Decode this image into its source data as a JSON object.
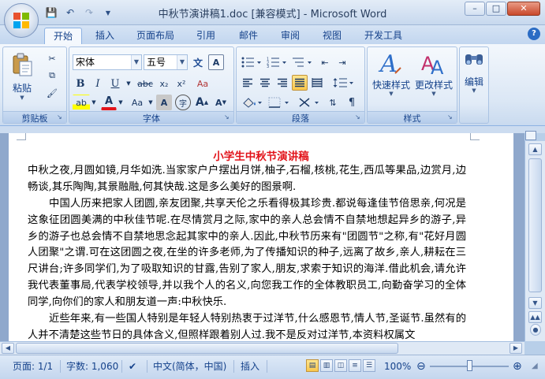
{
  "window": {
    "title": "中秋节演讲稿1.doc [兼容模式] - Microsoft Word",
    "controls": {
      "minimize": "–",
      "maximize": "□",
      "close": "✕"
    }
  },
  "qat": {
    "save": "💾",
    "undo": "↶",
    "redo": "↷"
  },
  "tabs": [
    {
      "label": "开始",
      "active": true
    },
    {
      "label": "插入"
    },
    {
      "label": "页面布局"
    },
    {
      "label": "引用"
    },
    {
      "label": "邮件"
    },
    {
      "label": "审阅"
    },
    {
      "label": "视图"
    },
    {
      "label": "开发工具"
    }
  ],
  "ribbon": {
    "clipboard": {
      "label": "剪贴板",
      "paste": "粘贴",
      "paste_arrow": "▼"
    },
    "font": {
      "label": "字体",
      "font_name": "宋体",
      "font_size": "五号",
      "grow": "A",
      "shrink": "A",
      "bold": "B",
      "italic": "I",
      "underline": "U",
      "strike": "abc",
      "subscript": "x₂",
      "superscript": "x²",
      "clear": "Aa",
      "highlight": "ab",
      "font_color": "A",
      "change_case": "Aa",
      "char_shading": "A",
      "enclose": "字",
      "phonetic": "文",
      "char_border": "A"
    },
    "paragraph": {
      "label": "段落"
    },
    "styles": {
      "label": "样式",
      "quick_styles": "快速样式",
      "change_styles": "更改样式"
    },
    "editing": {
      "label": "编辑"
    }
  },
  "document": {
    "title": "小学生中秋节演讲稿",
    "paragraphs": [
      "中秋之夜,月圆如镜,月华如洗.当家家户户摆出月饼,柚子,石榴,核桃,花生,西瓜等果品,边赏月,边畅谈,其乐陶陶,其景融融,何其快哉.这是多么美好的图景啊.",
      "中国人历来把家人团圆,亲友团聚,共享天伦之乐看得极其珍贵.都说每逢佳节倍思亲,何况是这象征团圆美满的中秋佳节呢.在尽情赏月之际,家中的亲人总会情不自禁地想起异乡的游子,异乡的游子也总会情不自禁地思念起其家中的亲人.因此,中秋节历来有\"团圆节\"之称,有\"花好月圆人团聚\"之谓.可在这团圆之夜,在坐的许多老师,为了传播知识的种子,远离了故乡,亲人,耕耘在三尺讲台;许多同学们,为了吸取知识的甘露,告别了家人,朋友,求索于知识的海洋.借此机会,请允许我代表董事局,代表学校领导,并以我个人的名义,向您我工作的全体教职员工,向勤奋学习的全体同学,向你们的家人和朋友道一声:中秋快乐.",
      "近些年来,有一些国人特别是年轻人特别热衷于过洋节,什么感恩节,情人节,圣诞节.虽然有的人并不清楚这些节日的具体含义,但照样跟着别人过.我不是反对过洋节,本资料权属文"
    ]
  },
  "status": {
    "page": "页面: 1/1",
    "words": "字数: 1,060",
    "language": "中文(简体，中国)",
    "insert_mode": "插入",
    "zoom": "100%",
    "zoom_minus": "⊖",
    "zoom_plus": "⊕"
  }
}
